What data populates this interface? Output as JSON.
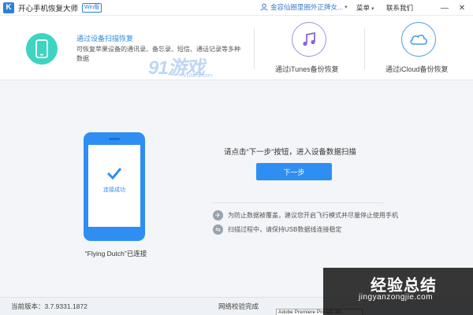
{
  "titlebar": {
    "logo_letter": "K",
    "app_title": "开心手机恢复大师",
    "badge": "Win版",
    "user_name": "金容仙圈里圈外正牌女...",
    "menu": "菜单",
    "contact": "联系我们",
    "minimize": "—",
    "close": "✕"
  },
  "modes": {
    "active": {
      "title": "通过设备扫描恢复",
      "description": "可恢复苹果设备的通讯录、备忘录、短信、通话记录等多种数据"
    },
    "itunes": {
      "label": "通过iTunes备份恢复"
    },
    "icloud": {
      "label": "通过iCloud备份恢复"
    },
    "watermark": "91游戏",
    "watermark_sub": "91danji.com"
  },
  "device": {
    "status": "连接成功",
    "name": "“Flying Dutch”已连接"
  },
  "main": {
    "instruction": "请点击“下一步”按钮，进入设备数据扫描",
    "next_button": "下一步",
    "tips": [
      "为防止数据被覆盖，建议您开启飞行模式并尽量停止使用手机",
      "扫描过程中，请保持USB数据线连接稳定"
    ]
  },
  "statusbar": {
    "version": "当前版本：3.7.9331.1872",
    "verify": "网络校验完成",
    "taskbar": "Adobe Premiere Pro CC 20..."
  },
  "corner_watermark": {
    "big": "经验总结",
    "small": "jingyanzongjie.com"
  },
  "colors": {
    "accent": "#2f8ef2",
    "teal": "#3dd4c2",
    "purple": "#a98be0",
    "blue_circle": "#4a9be8"
  }
}
